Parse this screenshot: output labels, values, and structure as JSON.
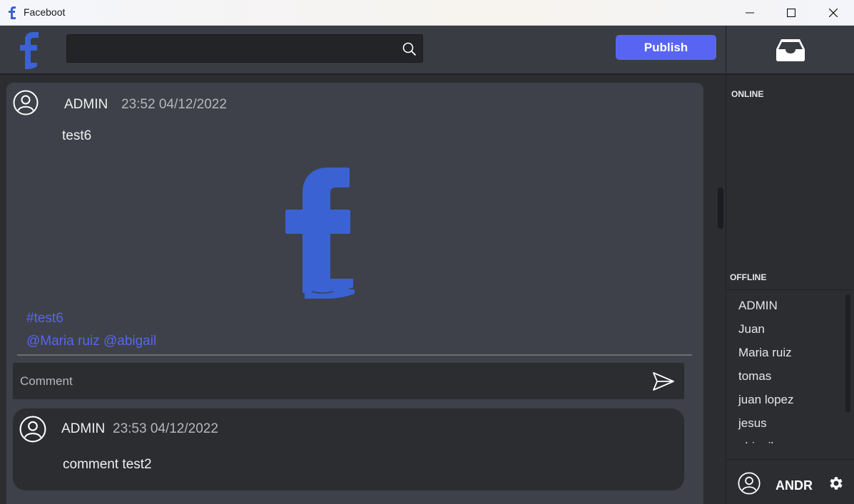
{
  "window": {
    "title": "Faceboot",
    "controls": [
      "minimize",
      "maximize",
      "close"
    ]
  },
  "topbar": {
    "search": {
      "value": "",
      "placeholder": ""
    },
    "publish_label": "Publish"
  },
  "post": {
    "author": "ADMIN",
    "timestamp": "23:52 04/12/2022",
    "text": "test6",
    "hashtags": "#test6",
    "mentions": "@Maria ruiz @abigail",
    "comment_placeholder": "Comment",
    "comments": [
      {
        "author": "ADMIN",
        "timestamp": "23:53 04/12/2022",
        "text": "comment test2"
      }
    ]
  },
  "sidebar": {
    "online_title": "ONLINE",
    "offline_title": "OFFLINE",
    "offline_users": [
      "ADMIN",
      "Juan",
      "Maria ruiz",
      "tomas",
      "juan lopez",
      "jesus",
      "abigail"
    ],
    "current_user": "ANDR"
  },
  "colors": {
    "accent": "#5865f2",
    "brand_blue": "#3b62d3",
    "panel_dark": "#2b2d31",
    "card": "#3e4149"
  }
}
